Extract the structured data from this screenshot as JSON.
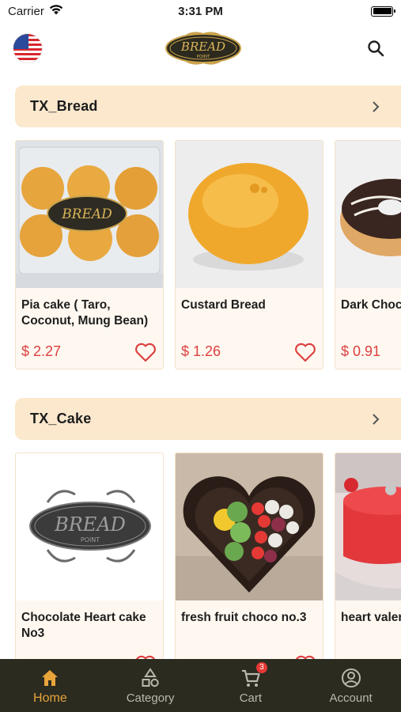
{
  "status_bar": {
    "carrier": "Carrier",
    "time": "3:31 PM"
  },
  "header": {
    "logo_text": "BREAD",
    "logo_subtext": "POINT"
  },
  "sections": [
    {
      "title": "TX_Bread",
      "products": [
        {
          "name": "Pia cake ( Taro, Coconut, Mung Bean)",
          "price": "$ 2.27"
        },
        {
          "name": "Custard Bread",
          "price": "$ 1.26"
        },
        {
          "name": "Dark Choc",
          "price": "$ 0.91"
        }
      ]
    },
    {
      "title": "TX_Cake",
      "products": [
        {
          "name": "Chocolate Heart cake No3",
          "price": ""
        },
        {
          "name": "fresh fruit choco no.3",
          "price": ""
        },
        {
          "name": "heart valer",
          "price": ""
        }
      ]
    }
  ],
  "bottom_nav": {
    "items": [
      {
        "label": "Home",
        "icon": "home-icon",
        "active": true
      },
      {
        "label": "Category",
        "icon": "category-icon",
        "active": false
      },
      {
        "label": "Cart",
        "icon": "cart-icon",
        "active": false,
        "badge": "3"
      },
      {
        "label": "Account",
        "icon": "account-icon",
        "active": false
      }
    ]
  },
  "colors": {
    "accent": "#e8a43b",
    "price": "#dc4040",
    "section_bg": "#fbe8cd",
    "nav_bg": "#2b2b20"
  }
}
